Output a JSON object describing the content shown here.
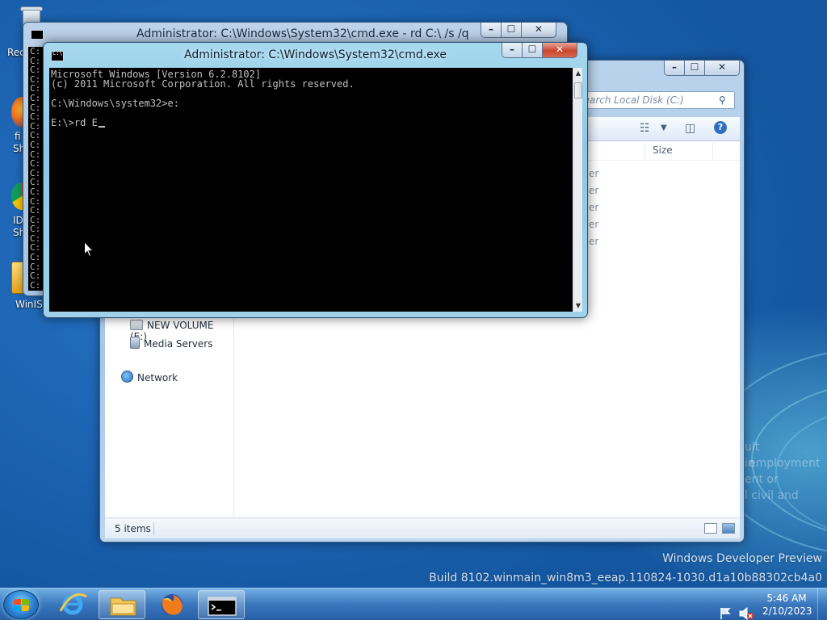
{
  "colors": {
    "desktop_bg": "#1f68b8",
    "terminal_bg": "#000000",
    "terminal_fg": "#c0c0c0",
    "close_button": "#c8452f"
  },
  "desktop": {
    "icons": [
      {
        "name": "recycle-bin-icon",
        "label": "Rec"
      },
      {
        "name": "firefox-shortcut-icon",
        "label_lines": [
          "fi",
          "Sh"
        ]
      },
      {
        "name": "chrome-shortcut-icon",
        "label_lines": [
          "ID",
          "Sh"
        ]
      },
      {
        "name": "winiso-icon",
        "label": "WinIS"
      }
    ],
    "watermark_ghost_lines": [
      "ult in",
      "employment",
      "ent or",
      "l civil and"
    ],
    "watermark": {
      "line1": "Windows Developer Preview",
      "line2": "Build 8102.winmain_win8m3_eeap.110824-1030.d1a10b88302cb4a0"
    }
  },
  "cmd_back": {
    "title": "Administrator: C:\\Windows\\System32\\cmd.exe - rd  C:\\ /s /q",
    "prompt_char": "C:",
    "line_count": 26
  },
  "cmd_front": {
    "title": "Administrator: C:\\Windows\\System32\\cmd.exe",
    "lines": [
      "Microsoft Windows [Version 6.2.8102]",
      "(c) 2011 Microsoft Corporation. All rights reserved.",
      "",
      "C:\\Windows\\system32>e:",
      "",
      "E:\\>rd E"
    ]
  },
  "explorer": {
    "search_placeholder": "Search Local Disk (C:)",
    "column_size": "Size",
    "type_fragments": [
      "er",
      "er",
      "er",
      "er",
      "er"
    ],
    "nav_items": [
      {
        "icon": "drive-icon",
        "label": "NEW VOLUME (E:)"
      },
      {
        "icon": "media-server-icon",
        "label": "Media Servers"
      },
      {
        "icon": "network-icon",
        "label": "Network"
      }
    ],
    "status_items": "5 items"
  },
  "taskbar": {
    "apps": [
      {
        "name": "internet-explorer",
        "icon": "ie-icon",
        "open": false
      },
      {
        "name": "file-explorer",
        "icon": "folder-icon",
        "open": true
      },
      {
        "name": "firefox",
        "icon": "firefox-icon",
        "open": false
      },
      {
        "name": "command-prompt",
        "icon": "cmd-icon",
        "open": true
      }
    ],
    "clock": {
      "time": "5:46 AM",
      "date": "2/10/2023"
    }
  }
}
